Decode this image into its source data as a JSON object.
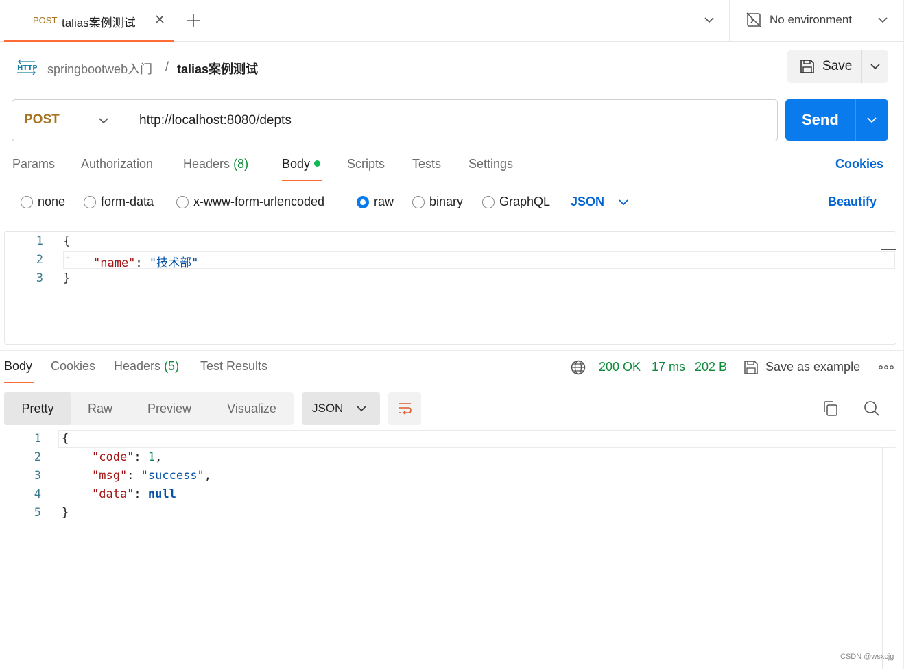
{
  "tab": {
    "method": "POST",
    "name": "talias案例测试"
  },
  "environment": {
    "label": "No environment"
  },
  "breadcrumb": {
    "collection": "springbootweb入门",
    "separator": "/",
    "request": "talias案例测试"
  },
  "toolbar": {
    "save_label": "Save",
    "send_label": "Send"
  },
  "request": {
    "method": "POST",
    "url": "http://localhost:8080/depts"
  },
  "request_tabs": {
    "params": "Params",
    "authorization": "Authorization",
    "headers": "Headers",
    "headers_count": "(8)",
    "body": "Body",
    "scripts": "Scripts",
    "tests": "Tests",
    "settings": "Settings",
    "cookies": "Cookies"
  },
  "body_types": {
    "none": "none",
    "form_data": "form-data",
    "urlencoded": "x-www-form-urlencoded",
    "raw": "raw",
    "binary": "binary",
    "graphql": "GraphQL",
    "selected": "raw",
    "format": "JSON",
    "beautify": "Beautify"
  },
  "request_body": {
    "line_numbers": [
      "1",
      "2",
      "3"
    ],
    "open_brace": "{",
    "key": "\"name\"",
    "colon": ": ",
    "value": "\"技术部\"",
    "close_brace": "}"
  },
  "response_tabs": {
    "body": "Body",
    "cookies": "Cookies",
    "headers": "Headers",
    "headers_count": "(5)",
    "test_results": "Test Results"
  },
  "response_status": {
    "status": "200 OK",
    "time": "17 ms",
    "size": "202 B",
    "save_example": "Save as example"
  },
  "response_view": {
    "pretty": "Pretty",
    "raw": "Raw",
    "preview": "Preview",
    "visualize": "Visualize",
    "format": "JSON",
    "selected": "Pretty"
  },
  "response_body": {
    "line_numbers": [
      "1",
      "2",
      "3",
      "4",
      "5"
    ],
    "open_brace": "{",
    "code_key": "\"code\"",
    "code_value": "1",
    "msg_key": "\"msg\"",
    "msg_value": "\"success\"",
    "data_key": "\"data\"",
    "data_value": "null",
    "close_brace": "}"
  },
  "colors": {
    "accent": "#ff6c37",
    "primary": "#097bed",
    "link": "#0265d2",
    "method": "#a7751f",
    "success": "#0f8a3a"
  },
  "watermark": "CSDN @wsxcjg"
}
